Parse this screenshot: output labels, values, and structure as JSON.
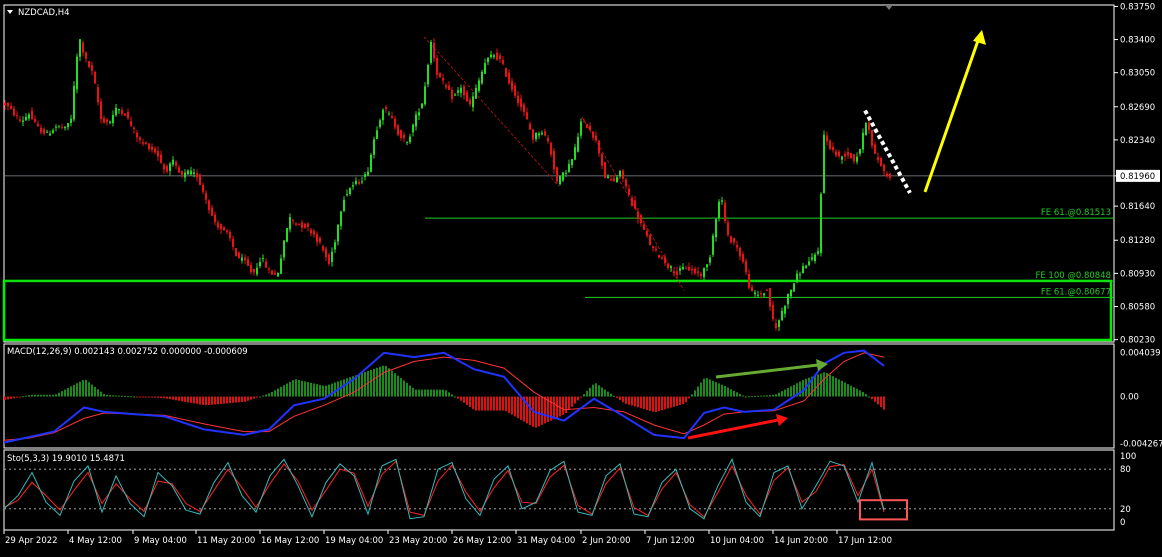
{
  "window": {
    "title": "NZDCAD,H4",
    "menu_icon": "triangle-down-icon"
  },
  "colors": {
    "background": "#000000",
    "frame": "#ffffff",
    "bull_candle": "#22dd22",
    "bear_candle": "#ee1111",
    "level_line": "#22cc22",
    "support_box": "#00ee00",
    "macd_line": "#2233ff",
    "signal_line": "#ff3333",
    "hist_pos": "#1a8c1a",
    "hist_neg": "#dd1111",
    "sto_main": "#33bbbb",
    "sto_signal": "#ff2222",
    "arrow_up": "#ffff00",
    "arrow_red": "#ff1111",
    "arrow_green": "#66aa33",
    "arrow_dotted": "#ffffff",
    "sto_box": "#ff5555"
  },
  "chart_data": [
    {
      "type": "candlestick",
      "symbol": "NZDCAD",
      "timeframe": "H4",
      "title": "NZDCAD,H4",
      "ylim": [
        0.80205,
        0.83765
      ],
      "y_ticks": [
        "0.83750",
        "0.83400",
        "0.83050",
        "0.82690",
        "0.82340",
        "0.81960",
        "0.81640",
        "0.81280",
        "0.80930",
        "0.80580",
        "0.80230"
      ],
      "x_ticks": [
        "29 Apr 2022",
        "4 May 12:00",
        "9 May 04:00",
        "11 May 20:00",
        "16 May 12:00",
        "19 May 04:00",
        "23 May 20:00",
        "26 May 12:00",
        "31 May 04:00",
        "2 Jun 20:00",
        "7 Jun 12:00",
        "10 Jun 04:00",
        "14 Jun 20:00",
        "17 Jun 12:00"
      ],
      "current_price": "0.81960",
      "close_path": [
        [
          0,
          0.8272
        ],
        [
          8,
          0.8263
        ],
        [
          16,
          0.8253
        ],
        [
          24,
          0.8262
        ],
        [
          32,
          0.8247
        ],
        [
          42,
          0.824
        ],
        [
          52,
          0.8249
        ],
        [
          60,
          0.8245
        ],
        [
          66,
          0.8257
        ],
        [
          74,
          0.8343
        ],
        [
          80,
          0.832
        ],
        [
          88,
          0.8303
        ],
        [
          96,
          0.8256
        ],
        [
          104,
          0.8252
        ],
        [
          112,
          0.8268
        ],
        [
          120,
          0.8262
        ],
        [
          128,
          0.8245
        ],
        [
          136,
          0.8231
        ],
        [
          144,
          0.8227
        ],
        [
          152,
          0.822
        ],
        [
          160,
          0.8201
        ],
        [
          168,
          0.821
        ],
        [
          176,
          0.8195
        ],
        [
          184,
          0.82
        ],
        [
          192,
          0.8196
        ],
        [
          200,
          0.8175
        ],
        [
          208,
          0.815
        ],
        [
          216,
          0.814
        ],
        [
          224,
          0.8132
        ],
        [
          232,
          0.811
        ],
        [
          240,
          0.8105
        ],
        [
          248,
          0.8092
        ],
        [
          256,
          0.811
        ],
        [
          264,
          0.8095
        ],
        [
          272,
          0.809
        ],
        [
          278,
          0.812
        ],
        [
          284,
          0.8152
        ],
        [
          292,
          0.8145
        ],
        [
          300,
          0.8143
        ],
        [
          308,
          0.8136
        ],
        [
          316,
          0.8122
        ],
        [
          324,
          0.8103
        ],
        [
          330,
          0.8128
        ],
        [
          338,
          0.8172
        ],
        [
          346,
          0.8185
        ],
        [
          354,
          0.819
        ],
        [
          362,
          0.8198
        ],
        [
          370,
          0.824
        ],
        [
          378,
          0.8268
        ],
        [
          386,
          0.8258
        ],
        [
          394,
          0.824
        ],
        [
          402,
          0.823
        ],
        [
          410,
          0.8256
        ],
        [
          418,
          0.8276
        ],
        [
          426,
          0.8338
        ],
        [
          432,
          0.8305
        ],
        [
          440,
          0.829
        ],
        [
          448,
          0.8278
        ],
        [
          456,
          0.829
        ],
        [
          464,
          0.8268
        ],
        [
          472,
          0.829
        ],
        [
          480,
          0.8315
        ],
        [
          488,
          0.8325
        ],
        [
          496,
          0.8317
        ],
        [
          504,
          0.8295
        ],
        [
          512,
          0.8278
        ],
        [
          520,
          0.826
        ],
        [
          528,
          0.8236
        ],
        [
          536,
          0.8245
        ],
        [
          544,
          0.823
        ],
        [
          552,
          0.819
        ],
        [
          560,
          0.82
        ],
        [
          568,
          0.8215
        ],
        [
          576,
          0.8252
        ],
        [
          584,
          0.8248
        ],
        [
          592,
          0.823
        ],
        [
          600,
          0.8195
        ],
        [
          608,
          0.819
        ],
        [
          616,
          0.82
        ],
        [
          624,
          0.8175
        ],
        [
          632,
          0.8155
        ],
        [
          640,
          0.8135
        ],
        [
          648,
          0.8118
        ],
        [
          656,
          0.811
        ],
        [
          664,
          0.81
        ],
        [
          672,
          0.8093
        ],
        [
          680,
          0.81
        ],
        [
          688,
          0.8095
        ],
        [
          696,
          0.8092
        ],
        [
          704,
          0.8105
        ],
        [
          710,
          0.8148
        ],
        [
          716,
          0.8178
        ],
        [
          722,
          0.8132
        ],
        [
          730,
          0.8125
        ],
        [
          738,
          0.8105
        ],
        [
          746,
          0.8072
        ],
        [
          754,
          0.807
        ],
        [
          762,
          0.8075
        ],
        [
          770,
          0.8032
        ],
        [
          776,
          0.805
        ],
        [
          784,
          0.8072
        ],
        [
          792,
          0.809
        ],
        [
          800,
          0.8102
        ],
        [
          808,
          0.8108
        ],
        [
          814,
          0.8118
        ],
        [
          818,
          0.824
        ],
        [
          826,
          0.8225
        ],
        [
          834,
          0.8215
        ],
        [
          842,
          0.822
        ],
        [
          850,
          0.8212
        ],
        [
          856,
          0.8228
        ],
        [
          862,
          0.826
        ],
        [
          868,
          0.822
        ],
        [
          874,
          0.8212
        ],
        [
          880,
          0.8198
        ],
        [
          886,
          0.8196
        ]
      ],
      "levels": [
        {
          "label": "FE 61.@0.81513",
          "price": 0.81513
        },
        {
          "label": "FE 100 @0.80848",
          "price": 0.80848
        },
        {
          "label": "FE 61.@0.80677",
          "price": 0.80677
        }
      ],
      "support_zone": [
        0.80205,
        0.8085
      ]
    },
    {
      "type": "line",
      "title": "MACD(12,26,9) 0.002143 0.002752 0.000000 -0.000609",
      "ylim": [
        -0.0047,
        0.0048
      ],
      "y_ticks": [
        "0.004039",
        "0.00",
        "-0.004267"
      ],
      "x": [
        0,
        25,
        50,
        80,
        100,
        130,
        160,
        200,
        240,
        265,
        290,
        320,
        350,
        380,
        410,
        440,
        470,
        500,
        530,
        560,
        590,
        620,
        650,
        680,
        700,
        720,
        740,
        770,
        800,
        820,
        840,
        860,
        880
      ],
      "series": [
        {
          "name": "MACD",
          "values": [
            -0.0042,
            -0.0037,
            -0.0032,
            -0.001,
            -0.0014,
            -0.0016,
            -0.0018,
            -0.003,
            -0.0035,
            -0.003,
            -0.0008,
            -0.0002,
            0.0016,
            0.004,
            0.0036,
            0.004,
            0.0025,
            0.0018,
            -0.0014,
            -0.0022,
            -0.0002,
            -0.0018,
            -0.0035,
            -0.0038,
            -0.0015,
            -0.001,
            -0.0014,
            -0.0012,
            0.0006,
            0.003,
            0.004,
            0.0042,
            0.0028
          ]
        },
        {
          "name": "Signal",
          "values": [
            -0.004,
            -0.0038,
            -0.0033,
            -0.002,
            -0.0015,
            -0.0016,
            -0.0017,
            -0.0025,
            -0.0032,
            -0.0032,
            -0.0018,
            -0.0008,
            0.0004,
            0.0022,
            0.0032,
            0.0036,
            0.0033,
            0.0026,
            0.0004,
            -0.0012,
            -0.001,
            -0.0014,
            -0.0026,
            -0.0034,
            -0.0026,
            -0.0016,
            -0.0014,
            -0.0013,
            -0.0004,
            0.0016,
            0.0032,
            0.004,
            0.0036
          ]
        }
      ]
    },
    {
      "type": "line",
      "title": "Sto(5,3,3) 19.9010 15.4871",
      "ylim": [
        0,
        100
      ],
      "y_ticks": [
        "100",
        "80",
        "20",
        "0"
      ],
      "levels": [
        80,
        20
      ],
      "x": [
        0,
        14,
        28,
        42,
        56,
        70,
        84,
        98,
        112,
        126,
        140,
        154,
        168,
        182,
        196,
        210,
        224,
        238,
        252,
        266,
        280,
        294,
        308,
        322,
        336,
        350,
        364,
        378,
        392,
        406,
        420,
        434,
        448,
        462,
        476,
        490,
        504,
        518,
        532,
        546,
        560,
        574,
        588,
        602,
        616,
        630,
        644,
        658,
        672,
        686,
        700,
        714,
        728,
        742,
        756,
        770,
        784,
        798,
        812,
        826,
        840,
        854,
        868,
        880
      ],
      "series": [
        {
          "name": "Main",
          "values": [
            20,
            40,
            75,
            30,
            10,
            62,
            85,
            15,
            70,
            28,
            8,
            75,
            55,
            18,
            12,
            60,
            90,
            40,
            15,
            70,
            95,
            55,
            8,
            60,
            88,
            70,
            12,
            85,
            95,
            5,
            8,
            80,
            90,
            35,
            10,
            65,
            85,
            20,
            30,
            78,
            92,
            15,
            10,
            70,
            88,
            12,
            8,
            60,
            80,
            20,
            5,
            55,
            95,
            30,
            8,
            75,
            85,
            20,
            55,
            92,
            85,
            30,
            90,
            18
          ]
        },
        {
          "name": "Signal",
          "values": [
            22,
            33,
            60,
            40,
            18,
            48,
            75,
            28,
            58,
            35,
            16,
            62,
            58,
            28,
            16,
            48,
            80,
            52,
            22,
            58,
            88,
            62,
            18,
            48,
            80,
            74,
            24,
            72,
            92,
            15,
            10,
            62,
            86,
            45,
            16,
            52,
            78,
            30,
            28,
            68,
            86,
            25,
            12,
            58,
            82,
            22,
            10,
            50,
            75,
            26,
            8,
            45,
            85,
            40,
            12,
            63,
            82,
            30,
            46,
            84,
            87,
            40,
            80,
            15
          ]
        }
      ],
      "annotation_box": [
        10,
        30
      ]
    }
  ]
}
